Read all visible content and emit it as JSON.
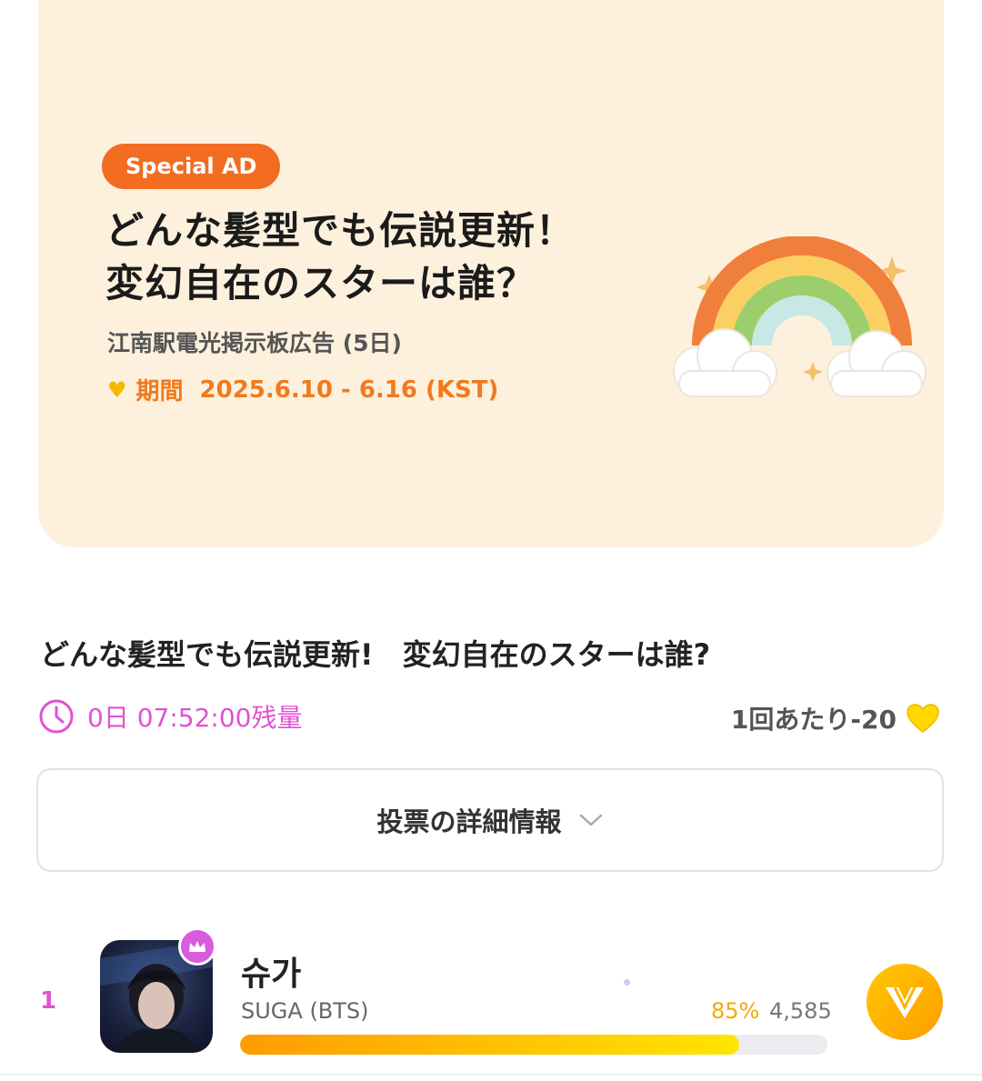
{
  "banner": {
    "badge": "Special AD",
    "headline_line1": "どんな髪型でも伝説更新！",
    "headline_line2": "変幻自在のスターは誰？",
    "subtitle": "江南駅電光掲示板広告 (5日)",
    "period_label": "期間",
    "period_value": "2025.6.10  -  6.16 (KST)",
    "icon": "heart-icon"
  },
  "poll": {
    "title": "どんな髪型でも伝説更新!　変幻自在のスターは誰?",
    "time_remaining": "0日 07:52:00残量",
    "cost": "1回あたり-20",
    "details_button": "投票の詳細情報"
  },
  "ranking": [
    {
      "rank": "1",
      "name": "슈가",
      "group": "SUGA (BTS)",
      "percent": "85%",
      "percent_value": 85,
      "votes": "4,585"
    }
  ],
  "colors": {
    "accent_orange": "#f26c22",
    "accent_pink": "#e052d4",
    "banner_bg": "#fdf1dd",
    "gold": "#f2a900"
  }
}
